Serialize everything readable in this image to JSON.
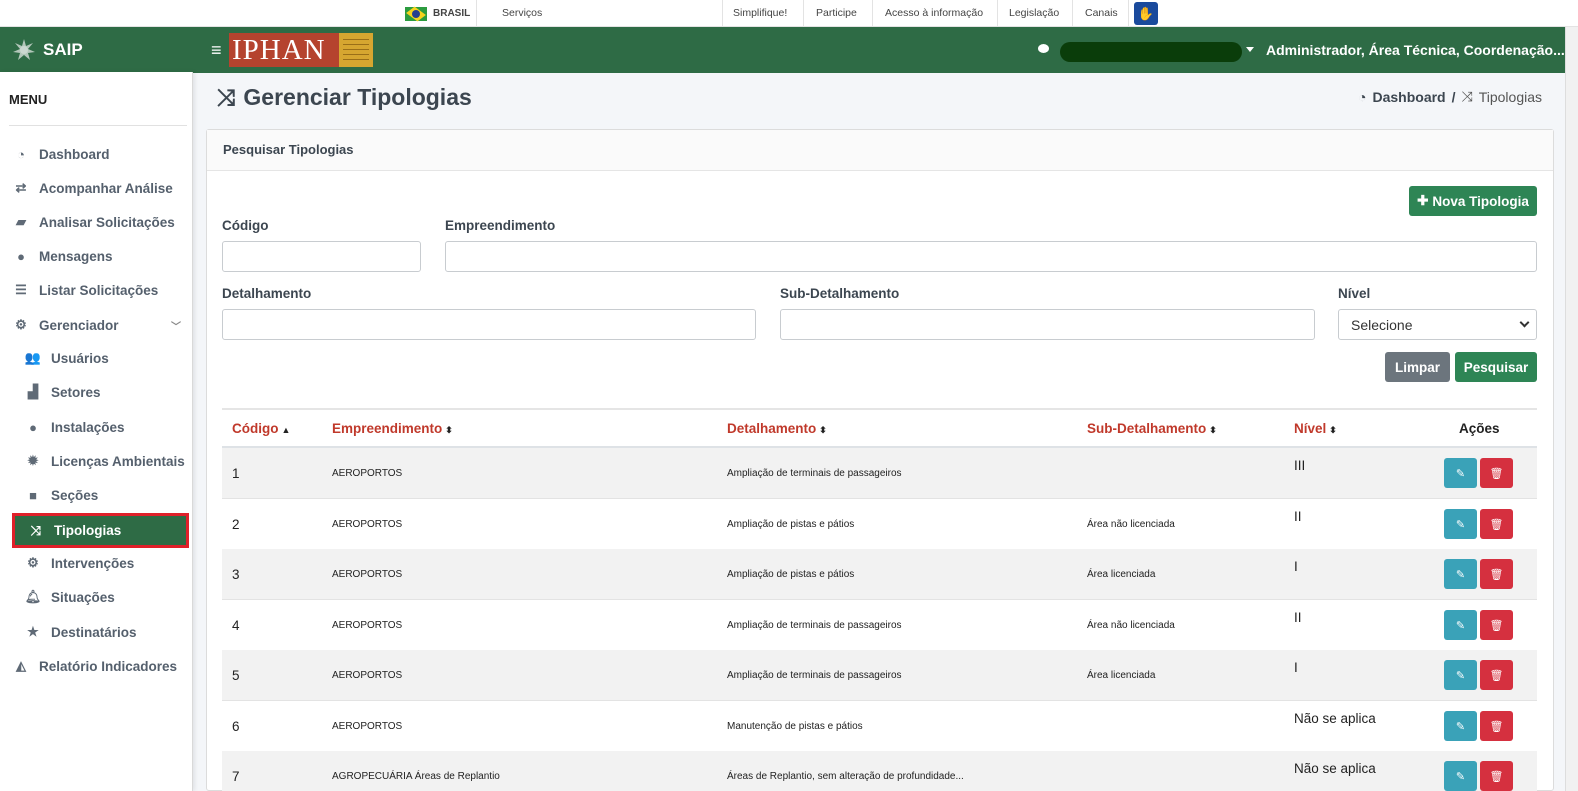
{
  "govbar": {
    "brasil": "BRASIL",
    "servicos": "Serviços",
    "links": [
      "Simplifique!",
      "Participe",
      "Acesso à informação",
      "Legislação",
      "Canais"
    ]
  },
  "brand": {
    "name": "SAIP"
  },
  "header": {
    "logo_text": "IPHAN",
    "user_role": "Administrador, Área Técnica, Coordenação..."
  },
  "sidebar": {
    "menu_title": "MENU",
    "items": [
      {
        "label": "Dashboard",
        "icon": "dashboard-icon"
      },
      {
        "label": "Acompanhar Análise",
        "icon": "exchange-icon"
      },
      {
        "label": "Analisar Solicitações",
        "icon": "book-icon"
      },
      {
        "label": "Mensagens",
        "icon": "comments-icon"
      },
      {
        "label": "Listar Solicitações",
        "icon": "list-icon"
      },
      {
        "label": "Gerenciador",
        "icon": "cogs-icon"
      },
      {
        "label": "Usuários",
        "icon": "users-icon"
      },
      {
        "label": "Setores",
        "icon": "industry-icon"
      },
      {
        "label": "Instalações",
        "icon": "circle-icon"
      },
      {
        "label": "Licenças Ambientais",
        "icon": "certificate-icon"
      },
      {
        "label": "Seções",
        "icon": "square-icon"
      },
      {
        "label": "Tipologias",
        "icon": "random-icon"
      },
      {
        "label": "Intervenções",
        "icon": "gear-icon"
      },
      {
        "label": "Situações",
        "icon": "bell-icon"
      },
      {
        "label": "Destinatários",
        "icon": "star-icon"
      },
      {
        "label": "Relatório Indicadores",
        "icon": "area-chart-icon"
      }
    ]
  },
  "page": {
    "title": "Gerenciar Tipologias",
    "breadcrumb": {
      "home": "Dashboard",
      "current": "Tipologias"
    }
  },
  "search": {
    "card_title": "Pesquisar Tipologias",
    "new_button": "Nova Tipologia",
    "codigo_label": "Código",
    "codigo_value": "",
    "empreendimento_label": "Empreendimento",
    "empreendimento_value": "",
    "detalhamento_label": "Detalhamento",
    "detalhamento_value": "",
    "subdetalhamento_label": "Sub-Detalhamento",
    "subdetalhamento_value": "",
    "nivel_label": "Nível",
    "nivel_selected": "Selecione",
    "clear_button": "Limpar",
    "search_button": "Pesquisar"
  },
  "table": {
    "headers": {
      "codigo": "Código",
      "empreendimento": "Empreendimento",
      "detalhamento": "Detalhamento",
      "subdetalhamento": "Sub-Detalhamento",
      "nivel": "Nível",
      "acoes": "Ações"
    },
    "rows": [
      {
        "codigo": "1",
        "empreendimento": "AEROPORTOS",
        "detalhamento": "Ampliação de terminais de passageiros",
        "subdetalhamento": "",
        "nivel": "III"
      },
      {
        "codigo": "2",
        "empreendimento": "AEROPORTOS",
        "detalhamento": "Ampliação de pistas e pátios",
        "subdetalhamento": "Área não licenciada",
        "nivel": "II"
      },
      {
        "codigo": "3",
        "empreendimento": "AEROPORTOS",
        "detalhamento": "Ampliação de pistas e pátios",
        "subdetalhamento": "Área licenciada",
        "nivel": "I"
      },
      {
        "codigo": "4",
        "empreendimento": "AEROPORTOS",
        "detalhamento": "Ampliação de terminais de passageiros",
        "subdetalhamento": "Área não licenciada",
        "nivel": "II"
      },
      {
        "codigo": "5",
        "empreendimento": "AEROPORTOS",
        "detalhamento": "Ampliação de terminais de passageiros",
        "subdetalhamento": "Área licenciada",
        "nivel": "I"
      },
      {
        "codigo": "6",
        "empreendimento": "AEROPORTOS",
        "detalhamento": "Manutenção de pistas e pátios",
        "subdetalhamento": "",
        "nivel": "Não se aplica"
      },
      {
        "codigo": "7",
        "empreendimento": "AGROPECUÁRIA Áreas de Replantio",
        "detalhamento": "Áreas de Replantio, sem alteração de profundidade...",
        "subdetalhamento": "",
        "nivel": "Não se aplica"
      }
    ]
  },
  "colors": {
    "brand_green": "#2e6b45",
    "button_green": "#2e8555",
    "sort_header_red": "#c0392b",
    "edit_blue": "#3aa2b8",
    "delete_red": "#d5303f",
    "active_outline": "#e0202a"
  }
}
